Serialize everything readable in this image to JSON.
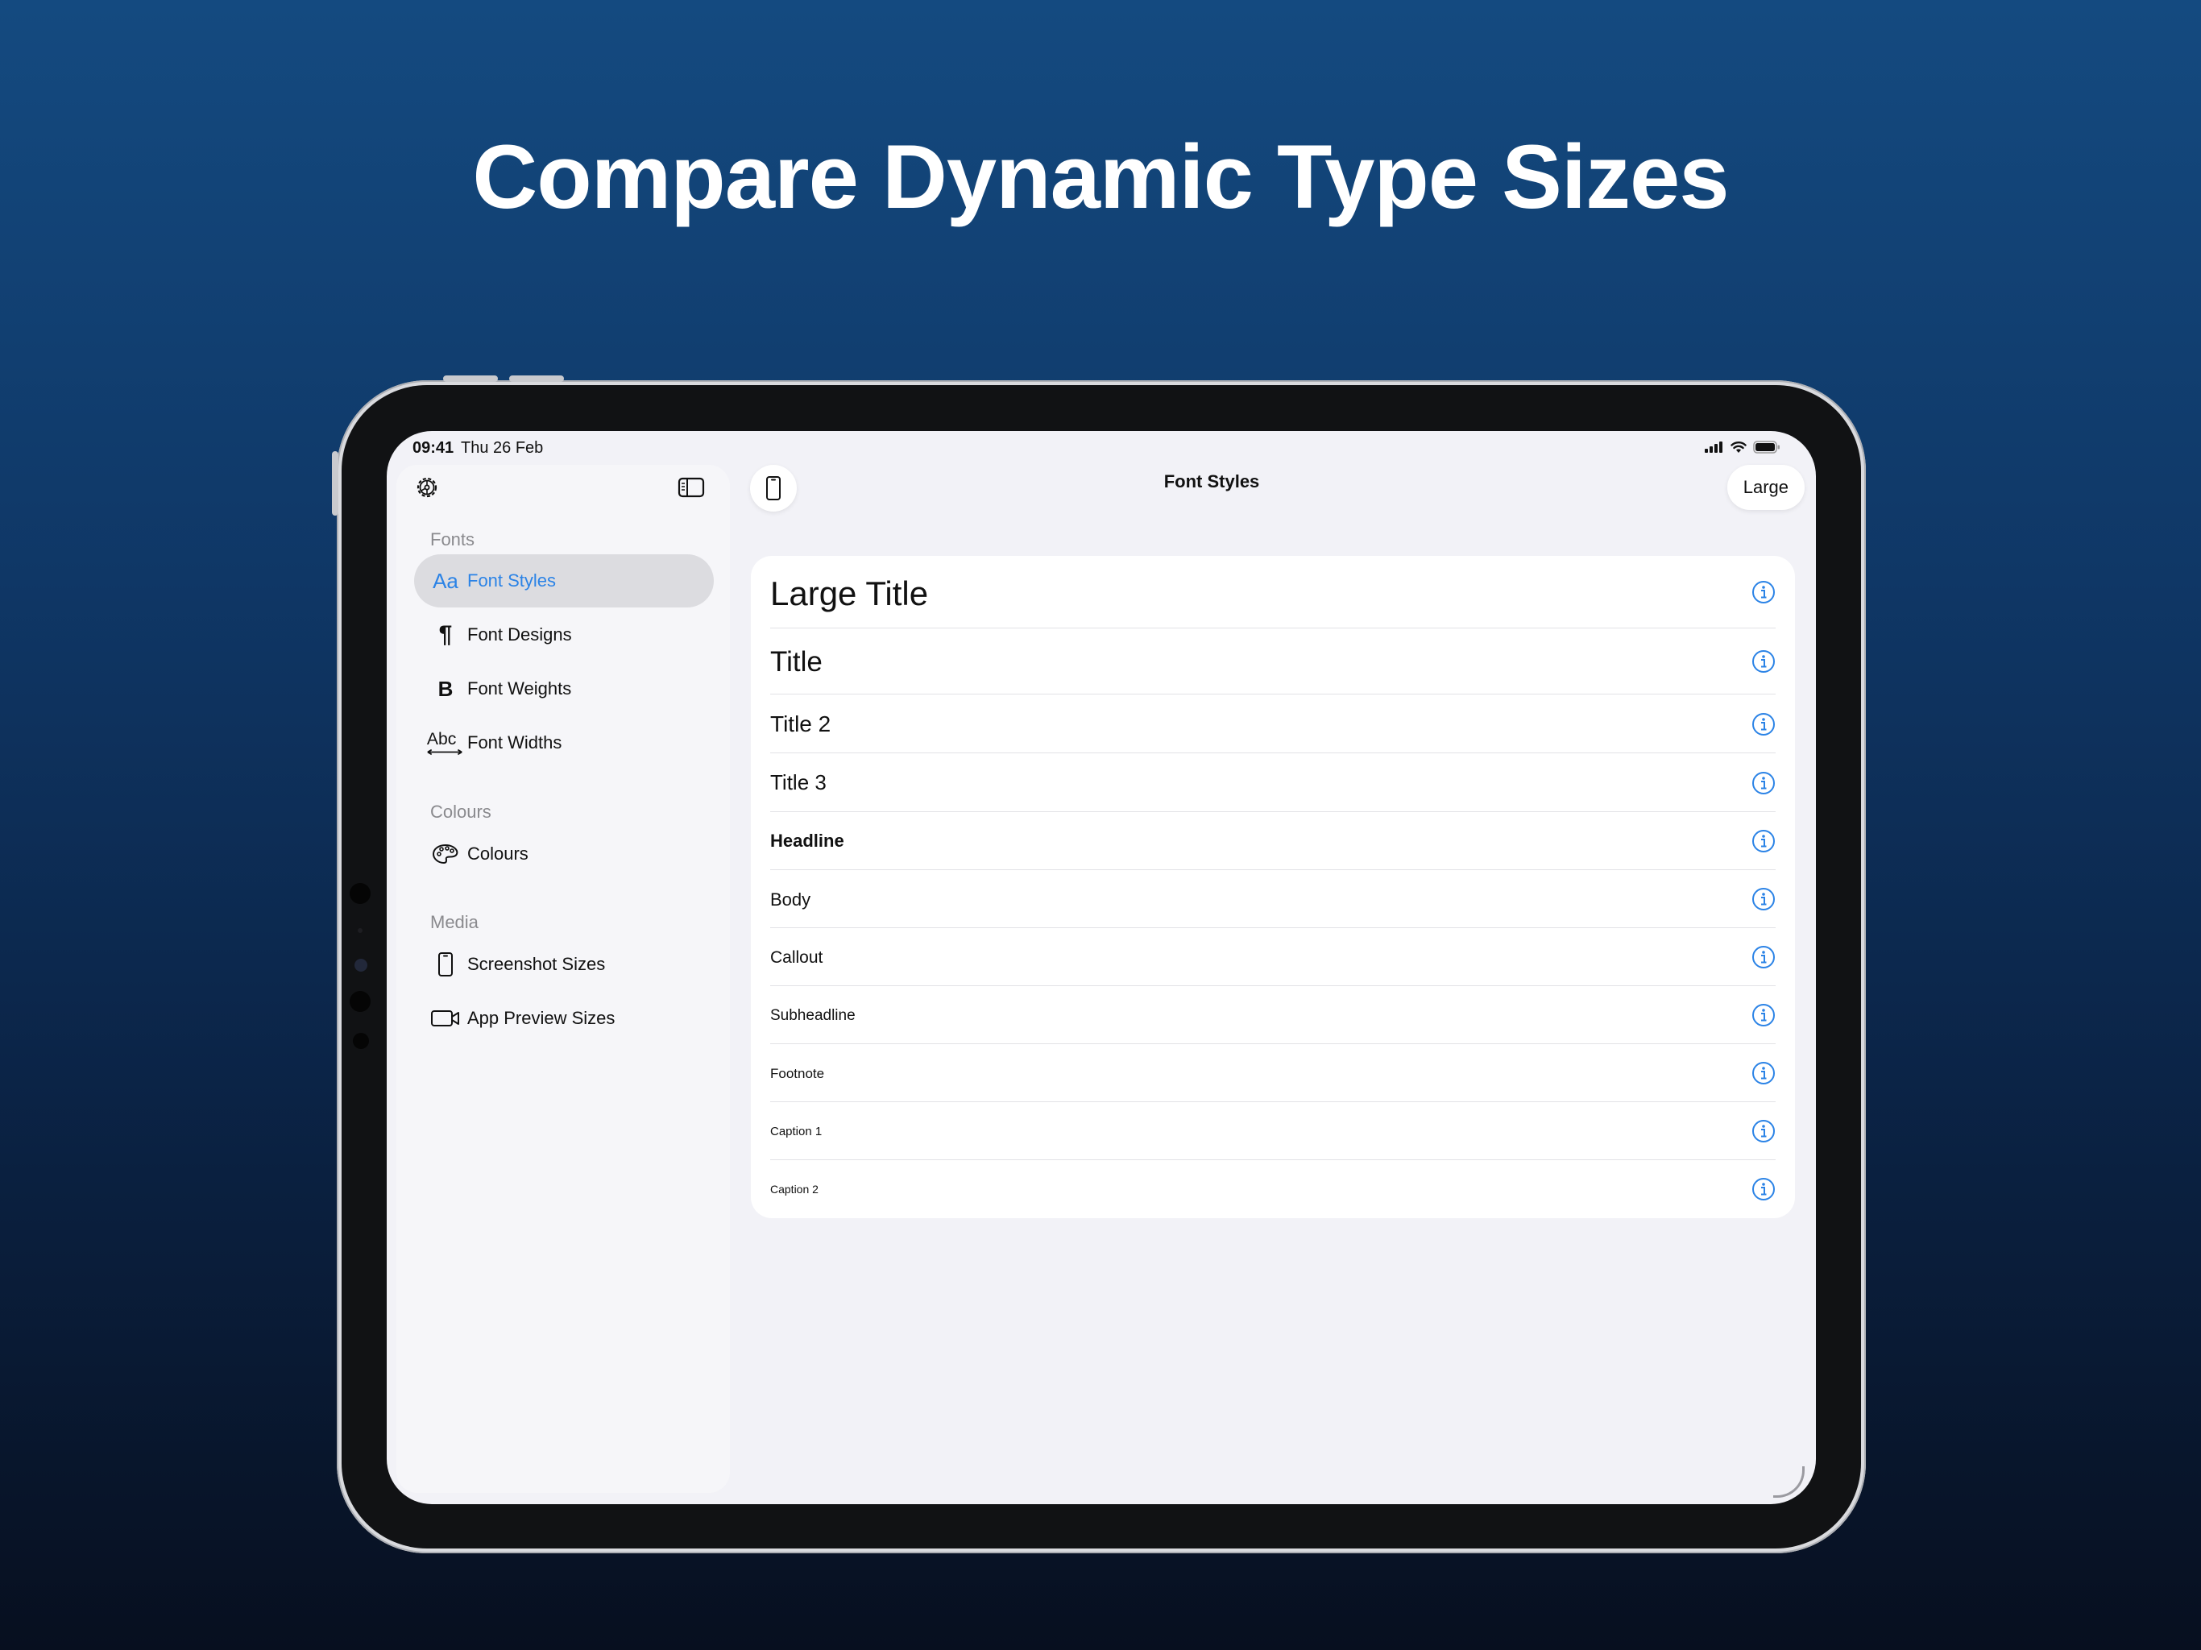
{
  "headline": "Compare Dynamic Type Sizes",
  "status_bar": {
    "time": "09:41",
    "date": "Thu 26 Feb"
  },
  "sidebar": {
    "sections": [
      {
        "title": "Fonts",
        "items": [
          {
            "label": "Font Styles",
            "icon": "font-styles-icon",
            "selected": true
          },
          {
            "label": "Font Designs",
            "icon": "pilcrow-icon"
          },
          {
            "label": "Font Weights",
            "icon": "bold-icon"
          },
          {
            "label": "Font Widths",
            "icon": "abc-width-icon"
          }
        ]
      },
      {
        "title": "Colours",
        "items": [
          {
            "label": "Colours",
            "icon": "palette-icon"
          }
        ]
      },
      {
        "title": "Media",
        "items": [
          {
            "label": "Screenshot Sizes",
            "icon": "phone-icon"
          },
          {
            "label": "App Preview Sizes",
            "icon": "video-camera-icon"
          }
        ]
      }
    ]
  },
  "main": {
    "title": "Font Styles",
    "size_button": "Large",
    "rows": [
      "Large Title",
      "Title",
      "Title 2",
      "Title 3",
      "Headline",
      "Body",
      "Callout",
      "Subheadline",
      "Footnote",
      "Caption 1",
      "Caption 2"
    ]
  },
  "colors": {
    "accent": "#2b83e6",
    "background": "#f2f2f7",
    "sidebar": "#f6f6f9"
  }
}
